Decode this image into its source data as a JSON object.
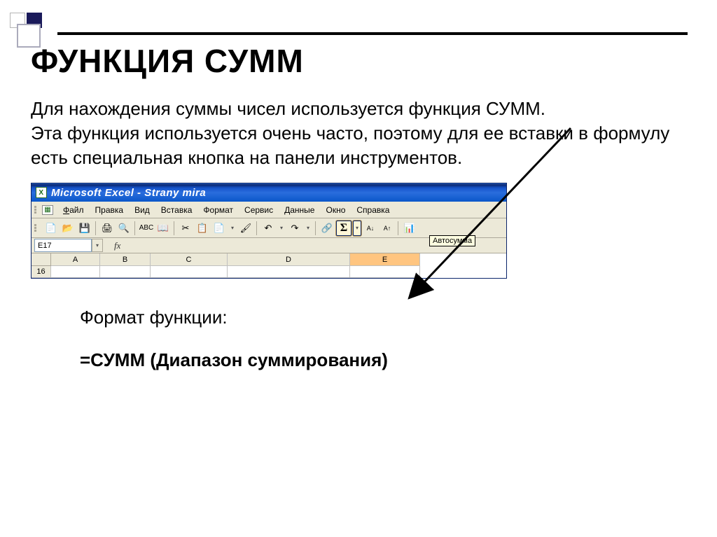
{
  "slide": {
    "title": "ФУНКЦИЯ СУММ",
    "paragraph1": "Для нахождения суммы чисел используется функция СУММ.",
    "paragraph2": "Эта функция используется очень часто, поэтому для ее вставки в формулу есть специальная кнопка на панели инструментов.",
    "format_label": "Формат функции:",
    "format_syntax": "=СУММ (Диапазон суммирования)"
  },
  "excel": {
    "title": "Microsoft Excel - Strany mira",
    "menu": {
      "file": "Файл",
      "edit": "Правка",
      "view": "Вид",
      "insert": "Вставка",
      "format": "Формат",
      "tools": "Сервис",
      "data": "Данные",
      "window": "Окно",
      "help": "Справка"
    },
    "namebox": "E17",
    "fx_label": "fx",
    "tooltip": "Автосумма",
    "columns": {
      "A": "A",
      "B": "B",
      "C": "C",
      "D": "D",
      "E": "E"
    },
    "rowhdr": "16",
    "sigma": "Σ"
  }
}
